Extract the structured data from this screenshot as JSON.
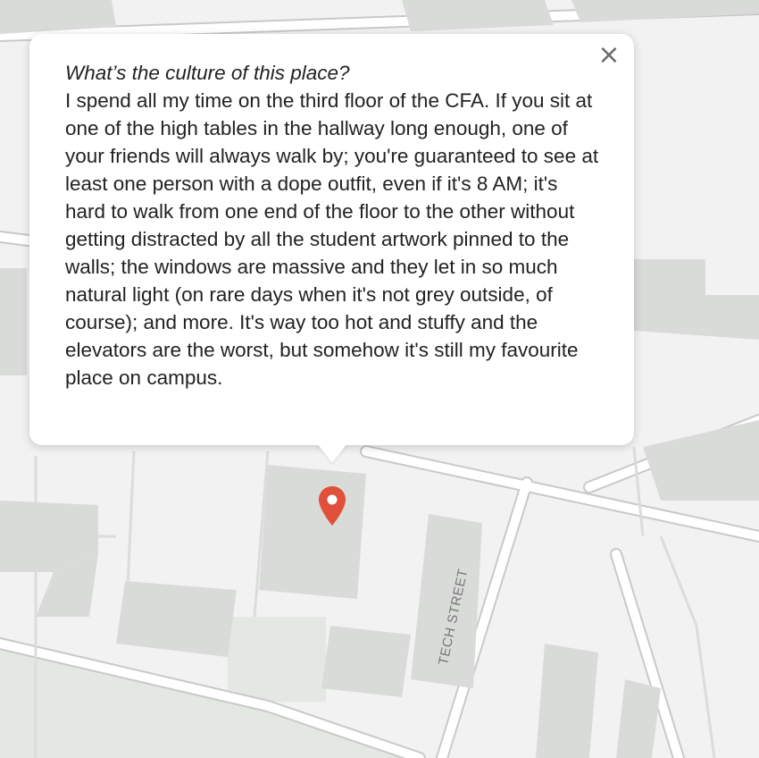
{
  "popup": {
    "question": "What’s the culture of this place?",
    "answer": "I spend all my time on the third floor of the CFA. If you sit at one of the high tables in the hallway long enough, one of your friends will always walk by; you're guaranteed to see at least one person with a dope outfit, even if it's 8 AM; it's hard to walk from one end of the floor to the other without getting distracted by all the student artwork pinned to the walls; the windows are massive and they let in so much natural light (on rare days when it's not grey outside, of course); and more. It's way too hot and stuffy and the elevators are the worst, but somehow it's still my favourite place on campus.",
    "close_symbol": "×"
  },
  "map": {
    "road_label": "TECH STREET",
    "marker_icon": "map-pin-icon",
    "colors": {
      "background": "#f2f2f2",
      "building": "#d9dbd9",
      "road": "#ffffff",
      "road_outline": "#c9c9c9",
      "park": "#e3e8e2",
      "marker": "#e0503a"
    }
  }
}
